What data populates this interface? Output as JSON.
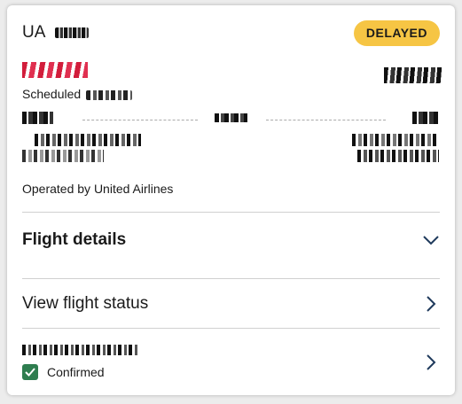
{
  "flight": {
    "carrier_code": "UA",
    "status": "DELAYED",
    "scheduled_label": "Scheduled",
    "operated_by": "Operated by United Airlines"
  },
  "sections": {
    "flight_details_label": "Flight details",
    "flight_status_label": "View flight status"
  },
  "booking": {
    "confirmed_label": "Confirmed"
  },
  "colors": {
    "status_badge": "#f6c544",
    "confirmed_check": "#2e7d4f",
    "route_accent": "#d21d3b"
  },
  "icons": {
    "flight_details": "chevron-down-icon",
    "flight_status": "chevron-right-icon",
    "booking": "chevron-right-icon",
    "confirmed": "check-icon"
  }
}
